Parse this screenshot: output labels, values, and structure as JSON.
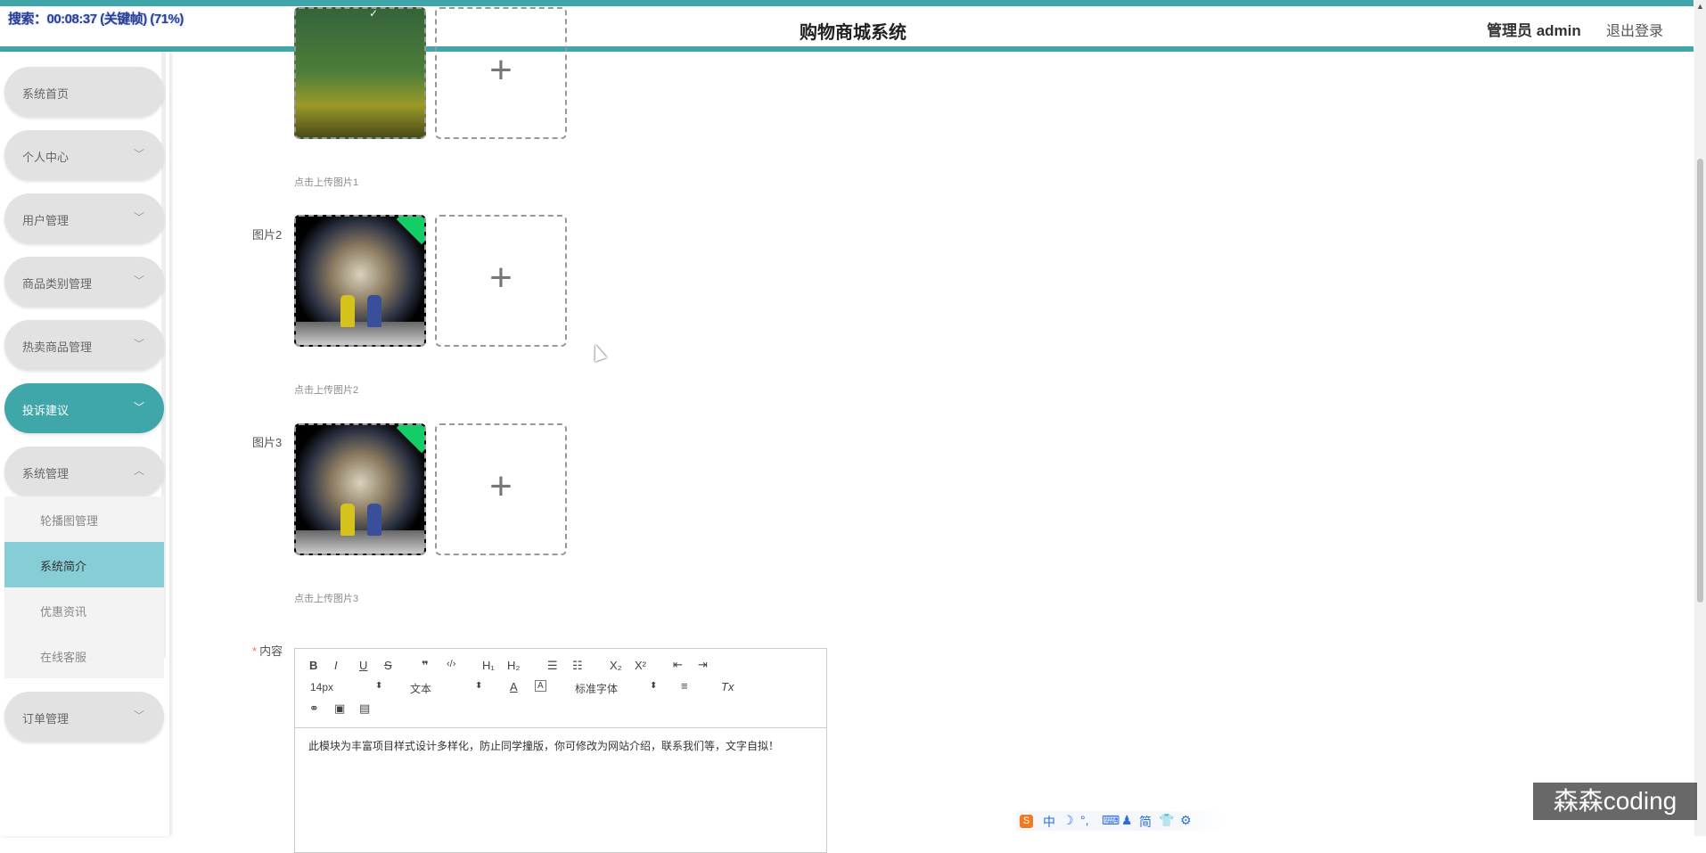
{
  "recording": {
    "text": "搜索：00:08:37 (关键帧) (71%)"
  },
  "header": {
    "title": "购物商城系统",
    "admin_label": "管理员 admin",
    "logout_label": "退出登录"
  },
  "sidebar": {
    "items": [
      {
        "label": "系统首页",
        "chevron": ""
      },
      {
        "label": "个人中心",
        "chevron": "﹀"
      },
      {
        "label": "用户管理",
        "chevron": "﹀"
      },
      {
        "label": "商品类别管理",
        "chevron": "﹀"
      },
      {
        "label": "热卖商品管理",
        "chevron": "﹀"
      },
      {
        "label": "投诉建议",
        "chevron": "﹀"
      },
      {
        "label": "系统管理",
        "chevron": "︿"
      },
      {
        "label": "订单管理",
        "chevron": "﹀"
      }
    ],
    "submenu": [
      {
        "label": "轮播图管理"
      },
      {
        "label": "系统简介"
      },
      {
        "label": "优惠资讯"
      },
      {
        "label": "在线客服"
      }
    ],
    "active_item": "投诉建议",
    "active_submenu": "系统简介"
  },
  "form": {
    "image1": {
      "tip": "点击上传图片1",
      "add_glyph": "+"
    },
    "image2": {
      "label": "图片2",
      "tip": "点击上传图片2",
      "add_glyph": "+"
    },
    "image3": {
      "label": "图片3",
      "tip": "点击上传图片3",
      "add_glyph": "+"
    },
    "content": {
      "required_mark": "*",
      "label": "内容",
      "toolbar": {
        "bold": "B",
        "italic": "I",
        "underline": "U",
        "strike": "S",
        "quote": "❞",
        "code": "‹/›",
        "h1": "H₁",
        "h2": "H₂",
        "ordered_list": "☰",
        "bullet_list": "☷",
        "subscript": "X₂",
        "superscript": "X²",
        "outdent": "⇤",
        "indent": "⇥",
        "size_value": "14px",
        "header_value": "文本",
        "font_value": "标准字体",
        "size_arrow": "⬍",
        "header_arrow": "⬍",
        "font_arrow": "⬍",
        "color": "A",
        "background": "A",
        "align": "≡",
        "clean": "Tx",
        "link": "⚭",
        "image": "▣",
        "video": "▤"
      },
      "value": "此模块为丰富项目样式设计多样化，防止同学撞版，你可修改为网站介绍，联系我们等，文字自拟！"
    }
  },
  "ime": {
    "logo": "S",
    "items": [
      "中",
      "☽",
      "°,",
      "⌨",
      "♟",
      "简",
      "👕",
      "⚙"
    ]
  },
  "watermark": {
    "text": "森森coding"
  },
  "colors": {
    "accent": "#3fa6a9",
    "submenu_active": "#87cdd5",
    "badge": "#13ce66"
  }
}
